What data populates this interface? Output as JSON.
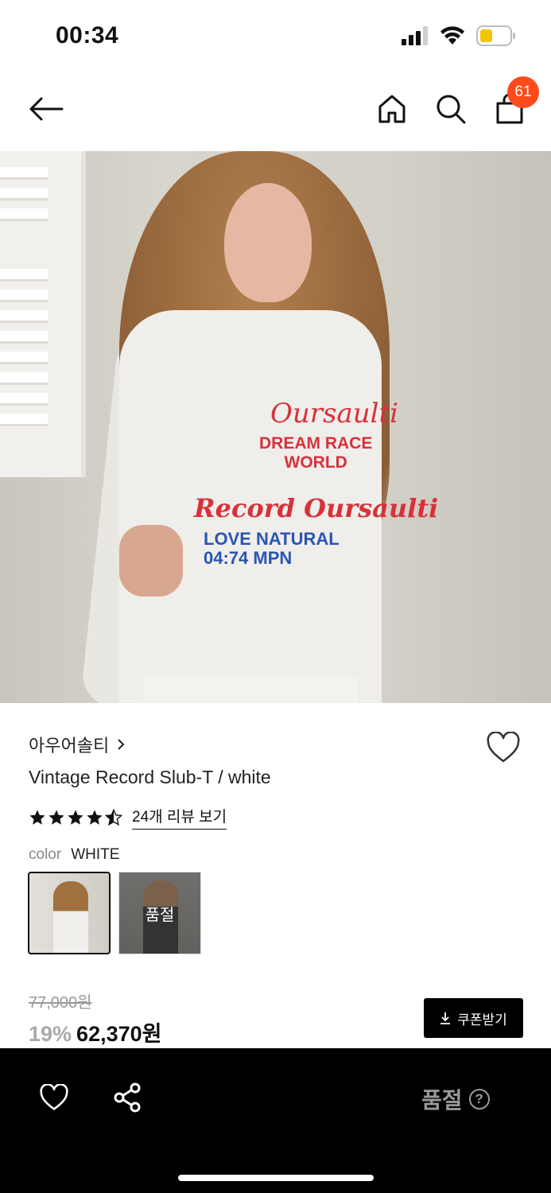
{
  "status_bar": {
    "time": "00:34"
  },
  "nav": {
    "cart_count": "61"
  },
  "product": {
    "brand": "아우어솔티",
    "name": "Vintage Record Slub-T / white",
    "rating": 4.5,
    "review_link": "24개 리뷰 보기",
    "color_label": "color",
    "color_value": "WHITE",
    "swatches": [
      {
        "state": "selected"
      },
      {
        "overlay_label": "품절"
      }
    ],
    "original_price": "77,000원",
    "discount": "19%",
    "sale_price": "62,370원",
    "coupon_button": "쿠폰받기"
  },
  "photo_print": {
    "line1": "Oursaulti",
    "line2a": "DREAM RACE",
    "line2b": "WORLD",
    "line3": "Record Oursaulti",
    "line4a": "LOVE NATURAL",
    "line4b": "04:74 MPN"
  },
  "bottom_bar": {
    "status_label": "품절"
  },
  "colors": {
    "badge": "#ff4a1c",
    "battery": "#f5c400",
    "bottom_bar": "#000000"
  }
}
